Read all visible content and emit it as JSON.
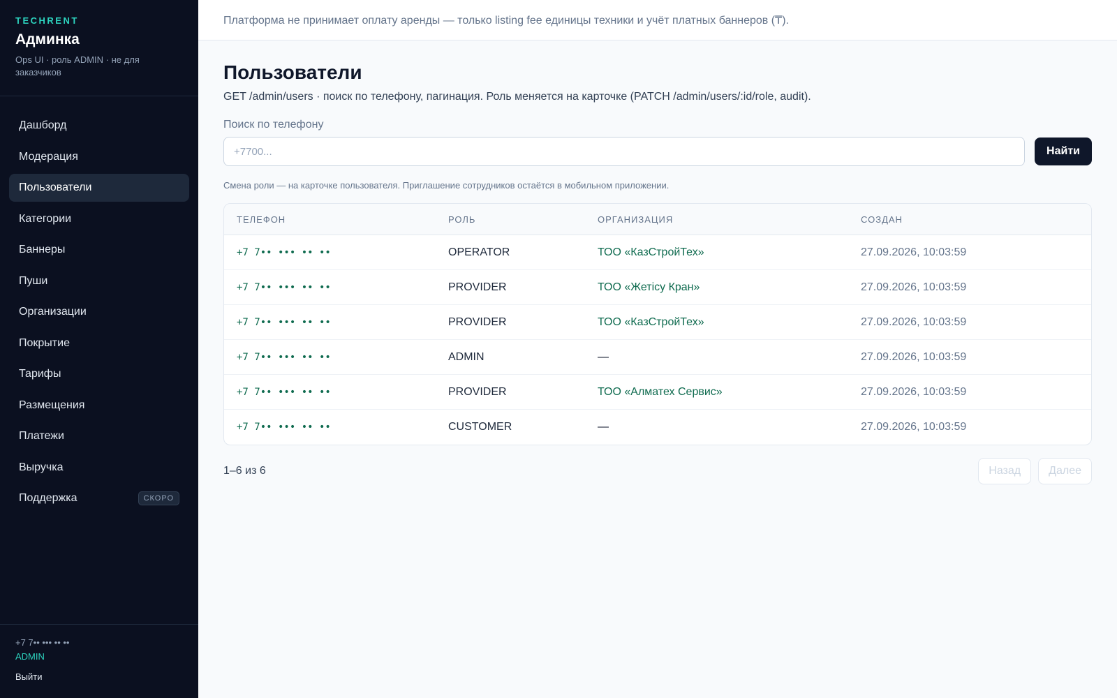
{
  "sidebar": {
    "brand_tag": "TECHRENT",
    "brand_title": "Админка",
    "brand_subtitle": "Ops UI · роль ADMIN · не для заказчиков",
    "items": [
      {
        "label": "Дашборд"
      },
      {
        "label": "Модерация"
      },
      {
        "label": "Пользователи",
        "active": true
      },
      {
        "label": "Категории"
      },
      {
        "label": "Баннеры"
      },
      {
        "label": "Пуши"
      },
      {
        "label": "Организации"
      },
      {
        "label": "Покрытие"
      },
      {
        "label": "Тарифы"
      },
      {
        "label": "Размещения"
      },
      {
        "label": "Платежи"
      },
      {
        "label": "Выручка"
      },
      {
        "label": "Поддержка",
        "badge": "СКОРО"
      }
    ],
    "footer": {
      "phone": "+7 7•• ••• •• ••",
      "role": "ADMIN",
      "logout": "Выйти"
    }
  },
  "topbar": {
    "notice": "Платформа не принимает оплату аренды — только listing fee единицы техники и учёт платных баннеров (₸)."
  },
  "main": {
    "title": "Пользователи",
    "subtitle": "GET /admin/users · поиск по телефону, пагинация. Роль меняется на карточке (PATCH /admin/users/:id/role, audit).",
    "search": {
      "label": "Поиск по телефону",
      "placeholder": "+7700...",
      "value": "",
      "button": "Найти"
    },
    "hint": "Смена роли — на карточке пользователя. Приглашение сотрудников остаётся в мобильном приложении.",
    "table": {
      "headers": [
        "ТЕЛЕФОН",
        "РОЛЬ",
        "ОРГАНИЗАЦИЯ",
        "СОЗДАН"
      ],
      "rows": [
        {
          "phone": "+7 7•• ••• •• ••",
          "role": "OPERATOR",
          "org": "ТОО «КазСтройТех»",
          "created": "27.09.2026, 10:03:59"
        },
        {
          "phone": "+7 7•• ••• •• ••",
          "role": "PROVIDER",
          "org": "ТОО «Жетісу Кран»",
          "created": "27.09.2026, 10:03:59"
        },
        {
          "phone": "+7 7•• ••• •• ••",
          "role": "PROVIDER",
          "org": "ТОО «КазСтройТех»",
          "created": "27.09.2026, 10:03:59"
        },
        {
          "phone": "+7 7•• ••• •• ••",
          "role": "ADMIN",
          "org": "—",
          "created": "27.09.2026, 10:03:59"
        },
        {
          "phone": "+7 7•• ••• •• ••",
          "role": "PROVIDER",
          "org": "ТОО «Алматех Сервис»",
          "created": "27.09.2026, 10:03:59"
        },
        {
          "phone": "+7 7•• ••• •• ••",
          "role": "CUSTOMER",
          "org": "—",
          "created": "27.09.2026, 10:03:59"
        }
      ]
    },
    "pagination": {
      "count": "1–6 из 6",
      "prev": "Назад",
      "next": "Далее"
    }
  }
}
